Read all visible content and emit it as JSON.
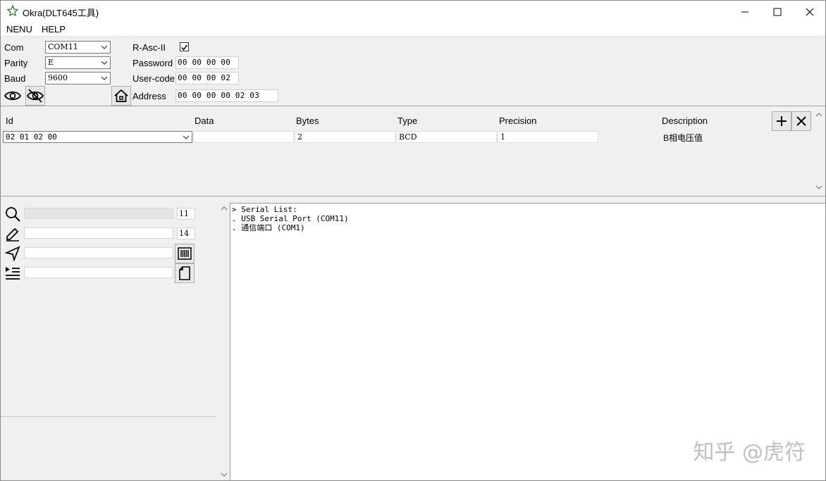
{
  "window": {
    "title": "Okra(DLT645工具)"
  },
  "menu": {
    "items": [
      "NENU",
      "HELP"
    ]
  },
  "settings": {
    "com_label": "Com",
    "com_value": "COM11",
    "parity_label": "Parity",
    "parity_value": "E",
    "baud_label": "Baud",
    "baud_value": "9600",
    "rascii_label": "R-Asc-II",
    "rascii_checked": true,
    "password_label": "Password",
    "password_value": "00 00 00 00",
    "usercode_label": "User-code",
    "usercode_value": "00 00 00 02",
    "address_label": "Address",
    "address_value": "00 00 00 00 02 03"
  },
  "icons": {
    "eye": "eye-icon",
    "eye_off": "eye-off-icon",
    "home": "home-icon",
    "add": "plus-icon",
    "remove": "close-icon",
    "search": "search-icon",
    "edit": "pencil-icon",
    "send": "send-icon",
    "list": "indent-list-icon",
    "barcode": "barcode-icon",
    "doc": "document-icon",
    "app": "leaf-icon"
  },
  "grid": {
    "headers": {
      "id": "Id",
      "data": "Data",
      "bytes": "Bytes",
      "type": "Type",
      "precision": "Precision",
      "description": "Description"
    },
    "row": {
      "id": "02 01 02 00",
      "data": "",
      "bytes": "2",
      "type": "BCD",
      "precision": "1",
      "description": "B相电压值"
    }
  },
  "tools": {
    "search_count": "11",
    "edit_count": "14"
  },
  "log": {
    "lines": [
      "> Serial List:",
      ". USB Serial Port (COM11)",
      ". 通信端口 (COM1)"
    ]
  },
  "watermark": "知乎 @虎符",
  "colors": {
    "accent": "#2e7d32",
    "background": "#f0f0f0"
  }
}
